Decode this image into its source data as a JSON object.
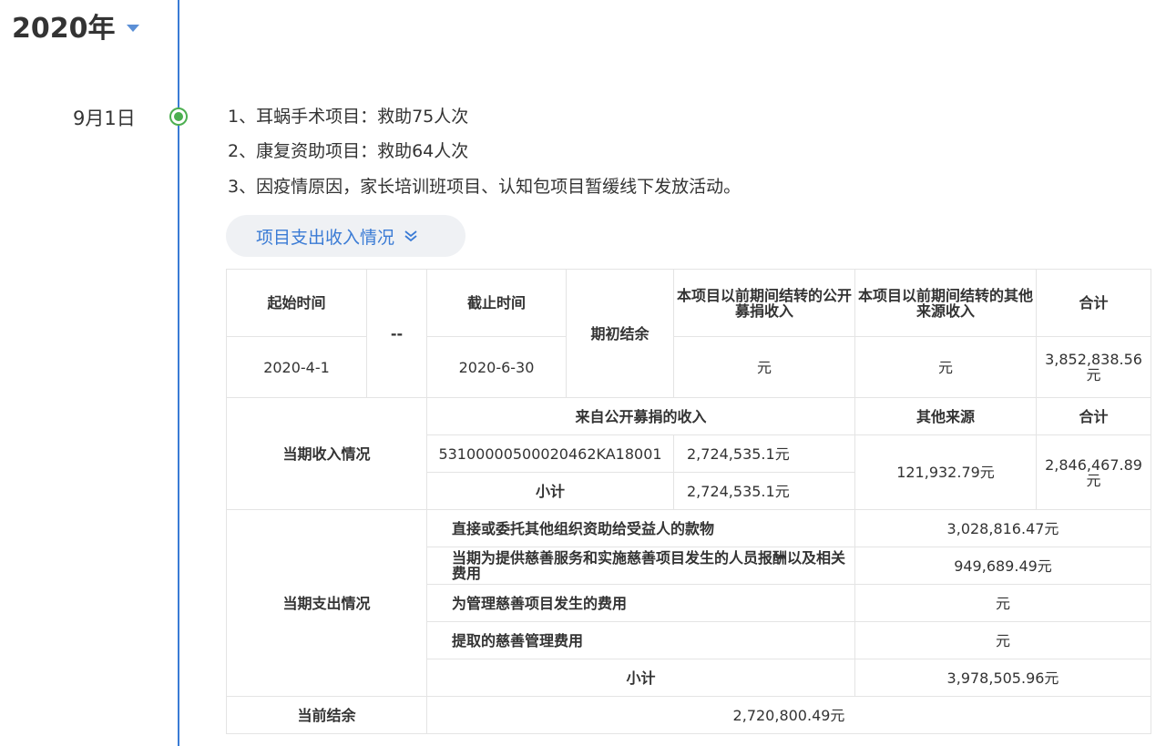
{
  "timeline": {
    "year": "2020年",
    "date": "9月1日",
    "items": [
      "1、耳蜗手术项目：救助75人次",
      "2、康复资助项目：救助64人次",
      "3、因疫情原因，家长培训班项目、认知包项目暂缓线下发放活动。"
    ],
    "toggle_label": "项目支出收入情况"
  },
  "colors": {
    "accent": "#3a7bd5",
    "dot": "#4caf50",
    "toggle_bg": "#eff1f4",
    "border": "#e4e4e4"
  },
  "table": {
    "start_time_label": "起始时间",
    "start_time": "2020-4-1",
    "dash": "--",
    "end_time_label": "截止时间",
    "end_time": "2020-6-30",
    "opening_balance_label": "期初结余",
    "prior_public_label": "本项目以前期间结转的公开募捐收入",
    "prior_public_value": "元",
    "prior_other_label": "本项目以前期间结转的其他来源收入",
    "prior_other_value": "元",
    "total_label": "合计",
    "prior_total_value": "3,852,838.56元",
    "income": {
      "label": "当期收入情况",
      "public_label": "来自公开募捐的收入",
      "other_label": "其他来源",
      "total_label": "合计",
      "record_no": "53100000500020462KA18001",
      "record_amount": "2,724,535.1元",
      "subtotal_label": "小计",
      "subtotal_amount": "2,724,535.1元",
      "other_amount": "121,932.79元",
      "total_amount": "2,846,467.89元"
    },
    "expense": {
      "label": "当期支出情况",
      "rows": [
        {
          "label": "直接或委托其他组织资助给受益人的款物",
          "value": "3,028,816.47元"
        },
        {
          "label": "当期为提供慈善服务和实施慈善项目发生的人员报酬以及相关费用",
          "value": "949,689.49元"
        },
        {
          "label": "为管理慈善项目发生的费用",
          "value": "元"
        },
        {
          "label": "提取的慈善管理费用",
          "value": "元"
        }
      ],
      "subtotal_label": "小计",
      "subtotal_value": "3,978,505.96元"
    },
    "balance_label": "当前结余",
    "balance_value": "2,720,800.49元"
  }
}
